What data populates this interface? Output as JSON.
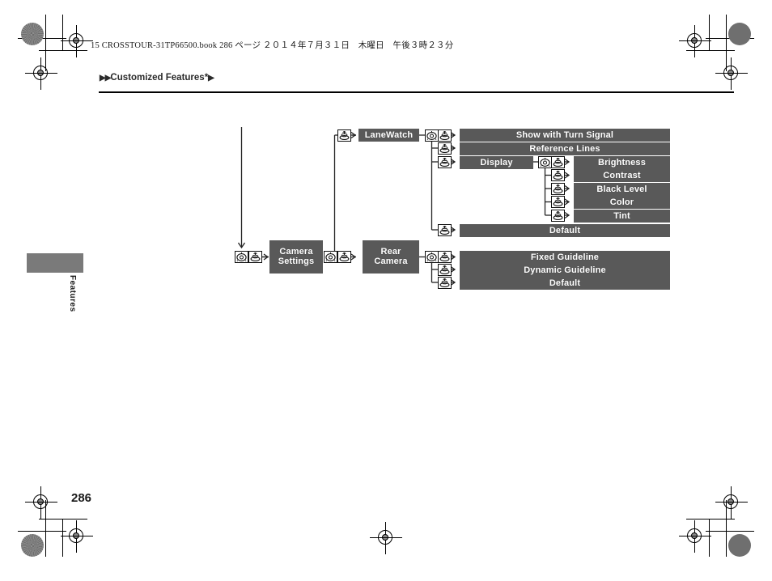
{
  "page": {
    "book_line": "15 CROSSTOUR-31TP66500.book   286 ページ   ２０１４年７月３１日　木曜日　午後３時２３分",
    "breadcrumb": "Customized Features*",
    "side_tab_label": "Features",
    "page_number": "286"
  },
  "diagram": {
    "nodes": {
      "camera_settings_line1": "Camera",
      "camera_settings_line2": "Settings",
      "lanewatch": "LaneWatch",
      "rear_camera_line1": "Rear",
      "rear_camera_line2": "Camera",
      "display": "Display"
    },
    "lanewatch_items": [
      "Show with Turn Signal",
      "Reference Lines",
      "Default"
    ],
    "display_items": [
      "Brightness",
      "Contrast",
      "Black Level",
      "Color",
      "Tint"
    ],
    "rear_camera_items": [
      "Fixed Guideline",
      "Dynamic Guideline",
      "Default"
    ],
    "icons": {
      "dial": "rotary-dial-icon",
      "press": "press-knob-icon"
    },
    "colors": {
      "bar": "#595959",
      "tab": "#7a7a7a",
      "line": "#222222"
    }
  }
}
